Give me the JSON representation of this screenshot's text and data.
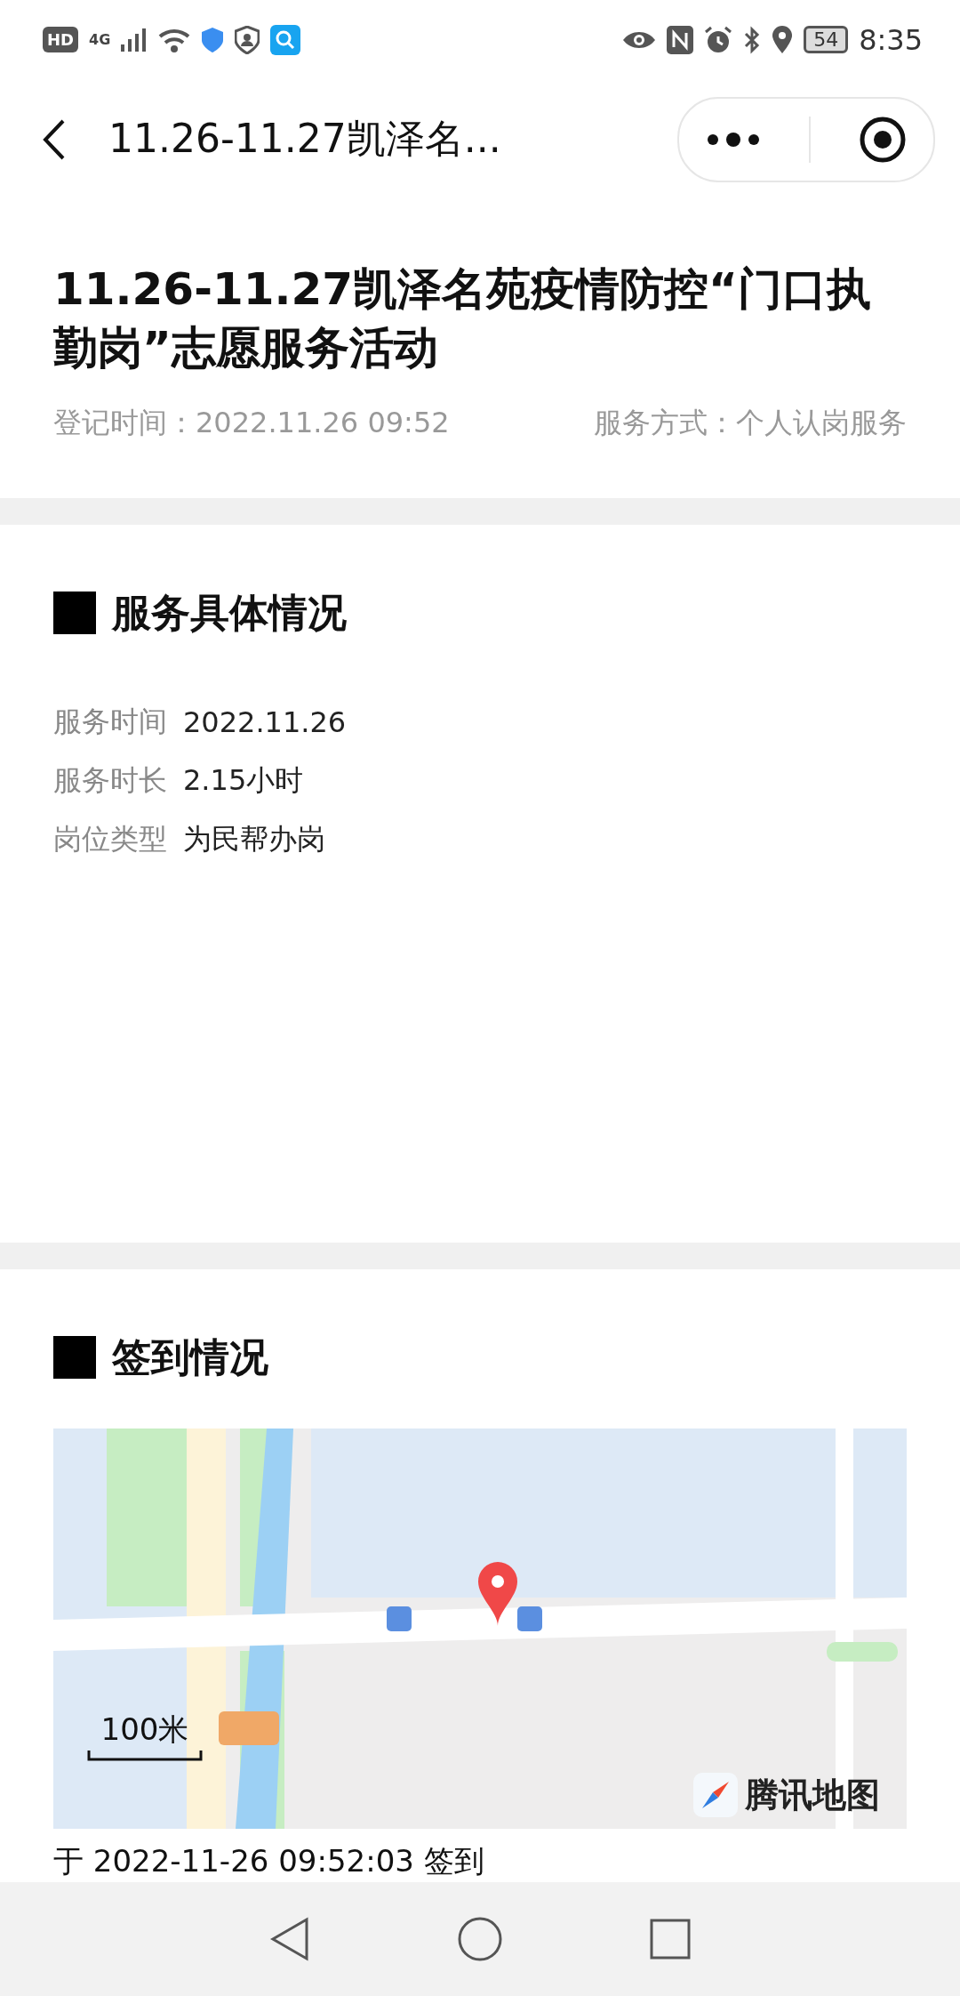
{
  "status_bar": {
    "hd_badge": "HD",
    "network": "4G",
    "battery": "54",
    "time": "8:35"
  },
  "nav_bar": {
    "title": "11.26-11.27凯泽名..."
  },
  "activity": {
    "title": "11.26-11.27凯泽名苑疫情防控“门口执勤岗”志愿服务活动",
    "registered": "登记时间：2022.11.26 09:52",
    "service_mode": "服务方式：个人认岗服务"
  },
  "service_details": {
    "heading": "服务具体情况",
    "rows": [
      {
        "label": "服务时间",
        "value": "2022.11.26"
      },
      {
        "label": "服务时长",
        "value": "2.15小时"
      },
      {
        "label": "岗位类型",
        "value": "为民帮办岗"
      }
    ]
  },
  "check_in": {
    "heading": "签到情况",
    "map": {
      "kind": "picture",
      "scale": "100米",
      "provider": "腾讯地图"
    },
    "record": "于 2022-11-26 09:52:03 签到"
  }
}
